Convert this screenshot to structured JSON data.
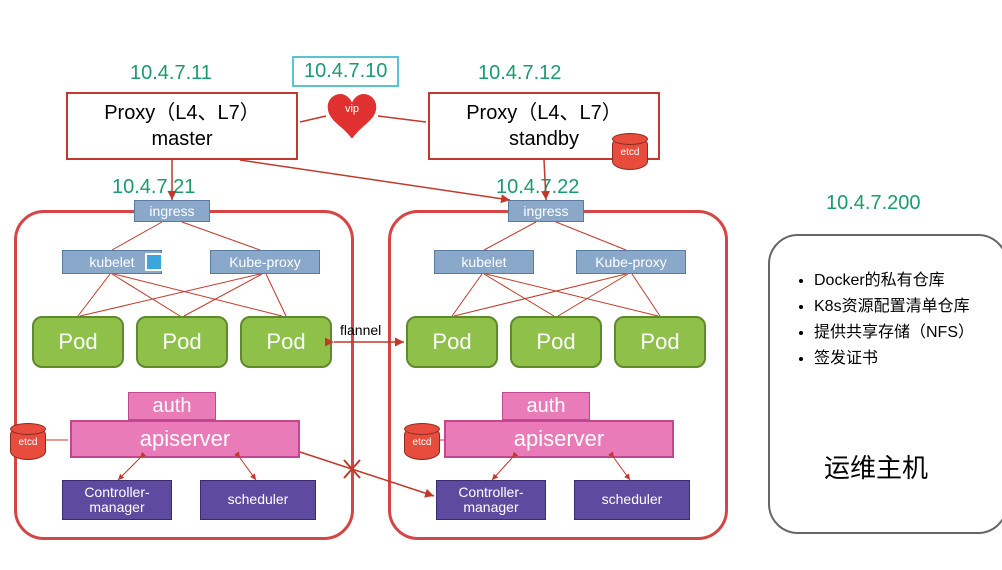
{
  "ips": {
    "vip": "10.4.7.10",
    "proxy_master": "10.4.7.11",
    "proxy_standby": "10.4.7.12",
    "node_left": "10.4.7.21",
    "node_right": "10.4.7.22",
    "ops": "10.4.7.200"
  },
  "proxy": {
    "master_line1": "Proxy（L4、L7）",
    "master_line2": "master",
    "standby_line1": "Proxy（L4、L7）",
    "standby_line2": "standby"
  },
  "vip_label": "vip",
  "etcd_label": "etcd",
  "components": {
    "ingress": "ingress",
    "kubelet": "kubelet",
    "kubeproxy": "Kube-proxy",
    "pod": "Pod",
    "auth": "auth",
    "apiserver": "apiserver",
    "controller_manager": "Controller-\nmanager",
    "scheduler": "scheduler"
  },
  "flannel": "flannel",
  "ops": {
    "title": "运维主机",
    "items": [
      "Docker的私有仓库",
      "K8s资源配置清单仓库",
      "提供共享存储（NFS）",
      "签发证书"
    ]
  }
}
